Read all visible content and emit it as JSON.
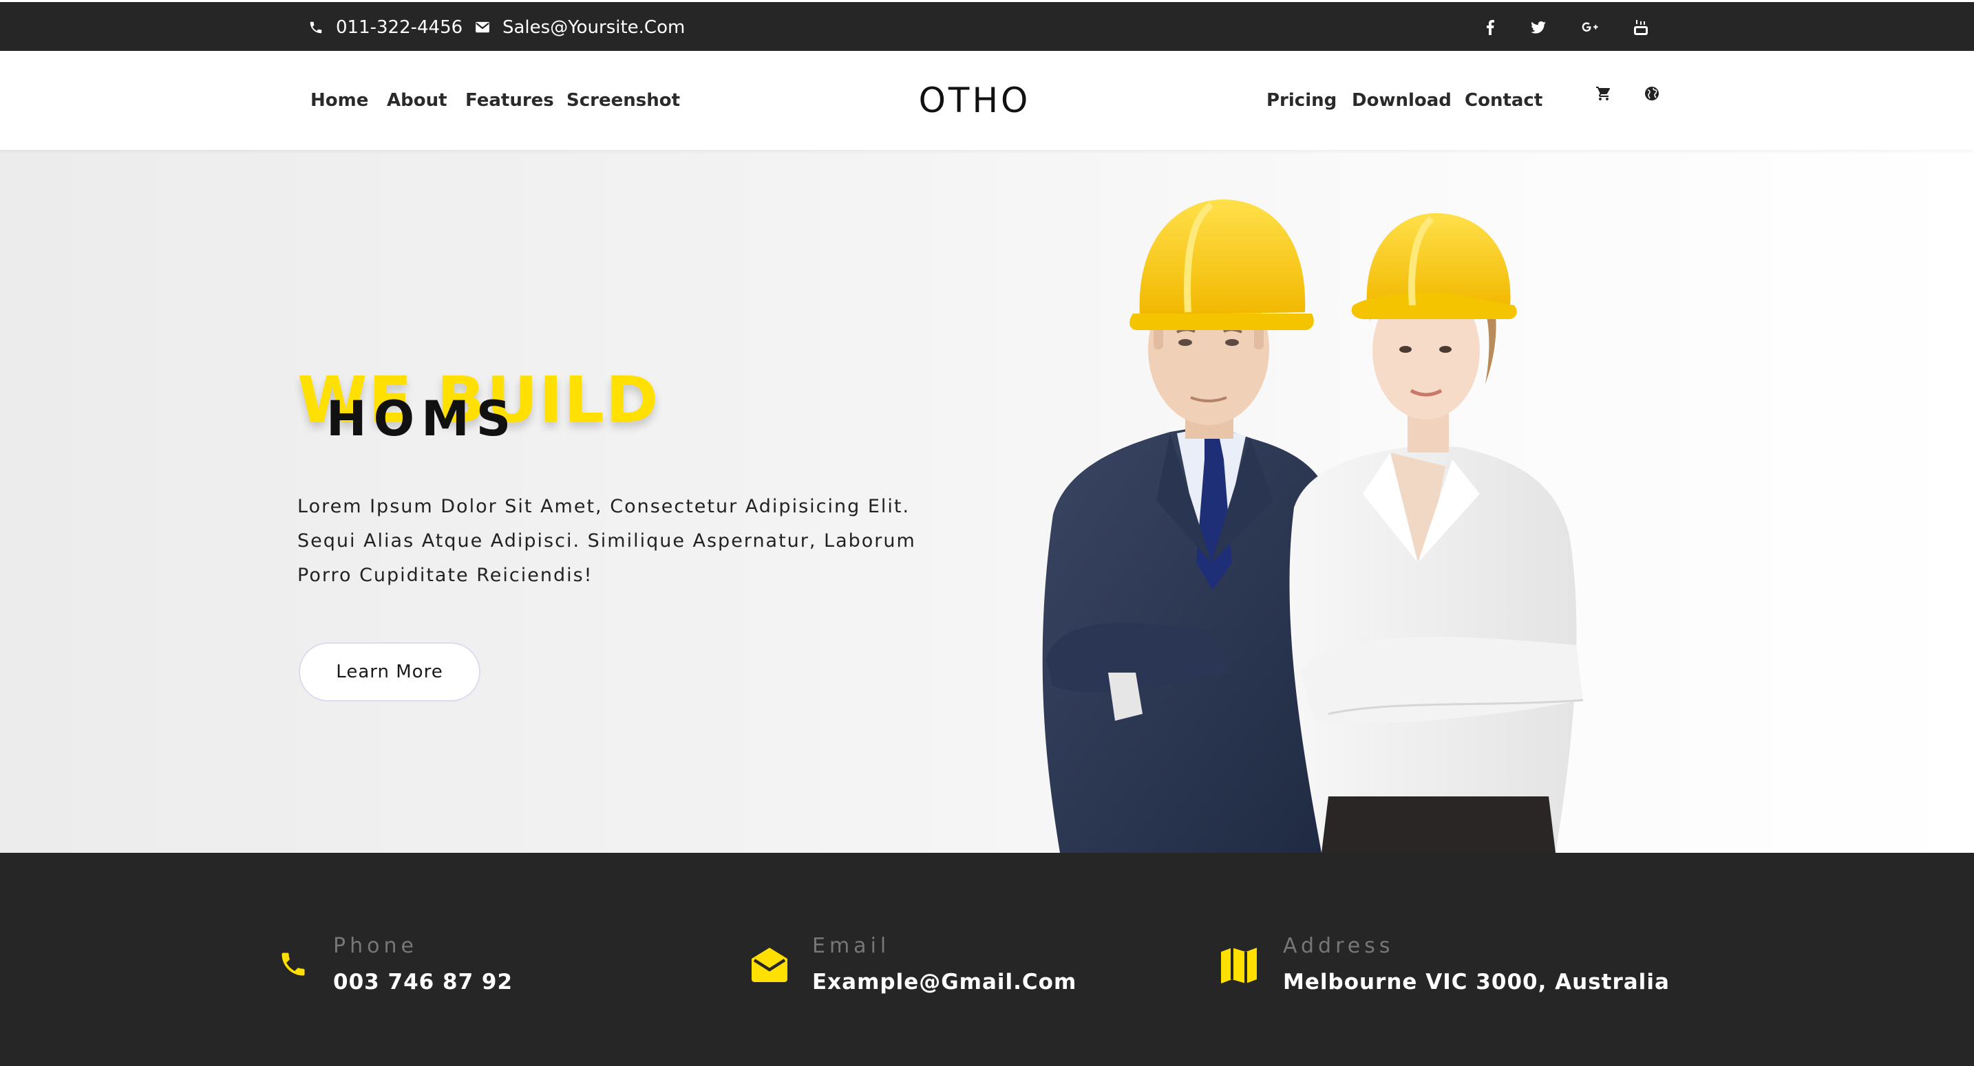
{
  "topbar": {
    "phone": "011-322-4456",
    "email": "Sales@Yoursite.Com",
    "social_icons": [
      "facebook-icon",
      "twitter-icon",
      "google-plus-icon",
      "youtube-icon"
    ]
  },
  "nav": {
    "brand": "OTHO",
    "left_links": [
      "Home",
      "About",
      "Features",
      "Screenshot"
    ],
    "right_links": [
      "Pricing",
      "Download",
      "Contact"
    ],
    "icons": [
      "cart-icon",
      "globe-icon"
    ]
  },
  "hero": {
    "background_word": "WE BUILD",
    "headline": "HOMS",
    "text": "Lorem Ipsum Dolor Sit Amet, Consectetur Adipisicing Elit. Sequi Alias Atque Adipisci. Similique Aspernatur, Laborum Porro Cupiditate Reiciendis!",
    "button": "Learn More"
  },
  "info": {
    "phone": {
      "label": "Phone",
      "value": "003 746 87 92",
      "icon": "phone-icon"
    },
    "email": {
      "label": "Email",
      "value": "Example@Gmail.Com",
      "icon": "envelope-open-icon"
    },
    "address": {
      "label": "Address",
      "value": "Melbourne VIC 3000, Australia",
      "icon": "map-icon"
    }
  },
  "colors": {
    "accent": "#ffe000",
    "dark": "#262626",
    "white": "#ffffff"
  }
}
